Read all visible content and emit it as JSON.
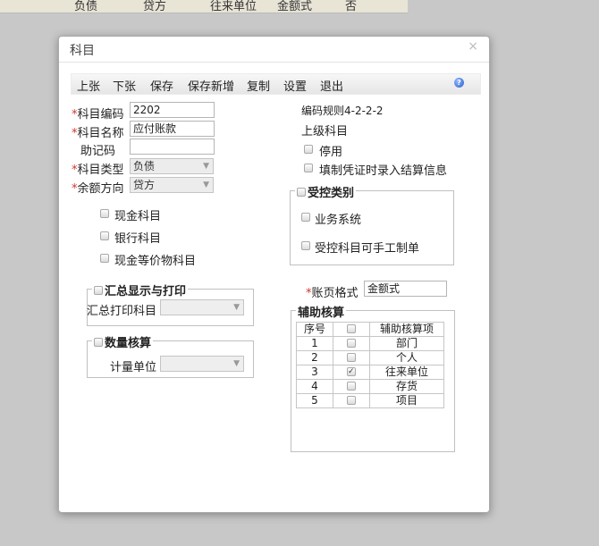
{
  "background_row": [
    "负债",
    "贷方",
    "往来单位",
    "金额式",
    "否"
  ],
  "dialog": {
    "title": "科目",
    "close": "×"
  },
  "toolbar": {
    "buttons": [
      "上张",
      "下张",
      "保存",
      "保存新增",
      "复制",
      "设置",
      "退出"
    ],
    "help": "?"
  },
  "form": {
    "code": {
      "label": "科目编码",
      "value": "2202"
    },
    "name": {
      "label": "科目名称",
      "value": "应付账款"
    },
    "mnemonic": {
      "label": "助记码",
      "value": ""
    },
    "type": {
      "label": "科目类型",
      "value": "负债"
    },
    "balance_dir": {
      "label": "余额方向",
      "value": "贷方"
    },
    "required_mark": "*",
    "rule": "编码规则4-2-2-2",
    "parent": "上级科目",
    "disable": {
      "label": "停用",
      "checked": false
    },
    "settle_info": {
      "label": "填制凭证时录入结算信息",
      "checked": false
    },
    "cash": {
      "label": "现金科目",
      "checked": false
    },
    "bank": {
      "label": "银行科目",
      "checked": false
    },
    "cash_equiv": {
      "label": "现金等价物科目",
      "checked": false
    }
  },
  "controlled": {
    "legend": "受控类别",
    "business": {
      "label": "业务系统",
      "checked": false
    },
    "manual": {
      "label": "受控科目可手工制单",
      "checked": false
    }
  },
  "summary": {
    "legend": "汇总显示与打印",
    "label": "汇总打印科目",
    "value": ""
  },
  "quantity": {
    "legend": "数量核算",
    "label": "计量单位",
    "value": ""
  },
  "ledger_format": {
    "label": "账页格式",
    "value": "金额式"
  },
  "auxiliary": {
    "legend": "辅助核算",
    "headers": [
      "序号",
      "",
      "辅助核算项"
    ],
    "rows": [
      {
        "no": "1",
        "checked": false,
        "item": "部门"
      },
      {
        "no": "2",
        "checked": false,
        "item": "个人"
      },
      {
        "no": "3",
        "checked": true,
        "item": "往来单位"
      },
      {
        "no": "4",
        "checked": false,
        "item": "存货"
      },
      {
        "no": "5",
        "checked": false,
        "item": "项目"
      }
    ]
  }
}
